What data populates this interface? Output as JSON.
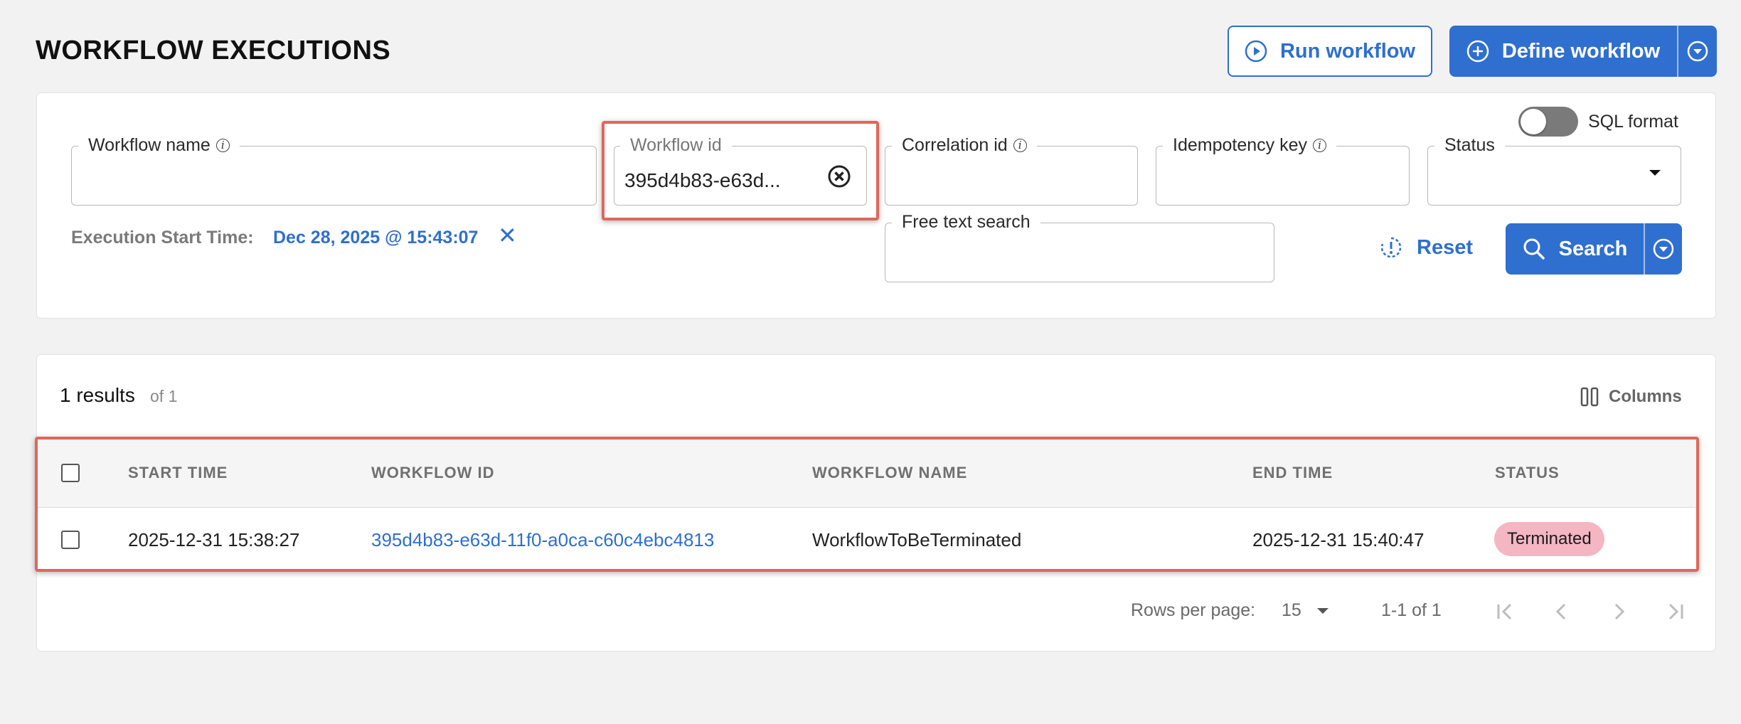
{
  "header": {
    "title": "WORKFLOW EXECUTIONS",
    "run_workflow_label": "Run workflow",
    "define_workflow_label": "Define workflow"
  },
  "filters": {
    "workflow_name": {
      "label": "Workflow name",
      "value": ""
    },
    "workflow_id": {
      "label": "Workflow id",
      "value": "395d4b83-e63d..."
    },
    "correlation_id": {
      "label": "Correlation id",
      "value": ""
    },
    "idempotency_key": {
      "label": "Idempotency key",
      "value": ""
    },
    "status": {
      "label": "Status",
      "value": ""
    },
    "free_text": {
      "label": "Free text search",
      "value": ""
    },
    "sql_format_label": "SQL format",
    "sql_format_on": false,
    "execution_start_label": "Execution Start Time:",
    "execution_start_value": "Dec 28, 2025 @ 15:43:07",
    "reset_label": "Reset",
    "search_label": "Search"
  },
  "results": {
    "count_label": "1 results",
    "of_label": "of 1",
    "columns_label": "Columns",
    "headers": [
      "START TIME",
      "WORKFLOW ID",
      "WORKFLOW NAME",
      "END TIME",
      "STATUS"
    ],
    "rows": [
      {
        "start_time": "2025-12-31 15:38:27",
        "workflow_id": "395d4b83-e63d-11f0-a0ca-c60c4ebc4813",
        "workflow_name": "WorkflowToBeTerminated",
        "end_time": "2025-12-31 15:40:47",
        "status": "Terminated"
      }
    ]
  },
  "pagination": {
    "rows_per_page_label": "Rows per page:",
    "rows_per_page_value": "15",
    "range_label": "1-1 of 1"
  },
  "colors": {
    "accent": "#2f6fcf",
    "highlight": "#e0675a",
    "terminated_badge": "#f4b6c3"
  }
}
